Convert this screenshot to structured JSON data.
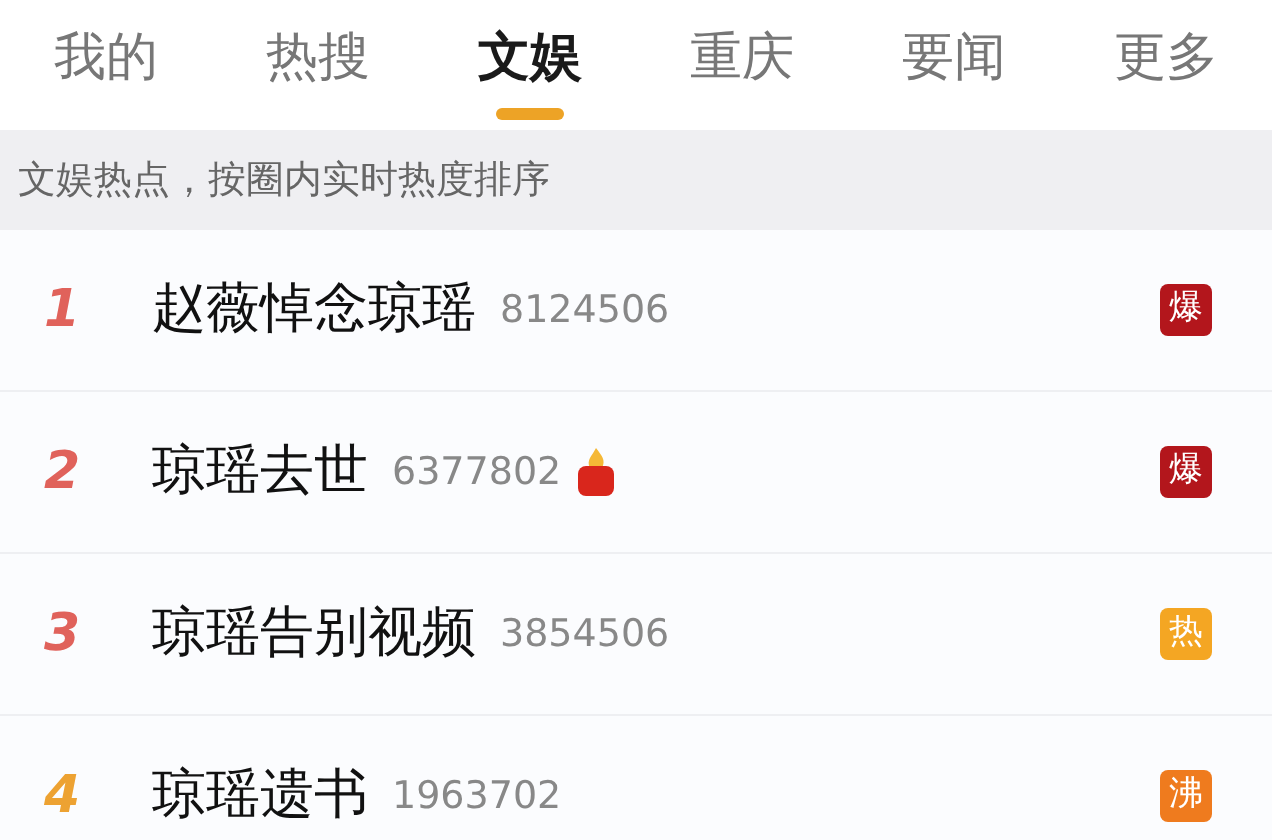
{
  "tabs": [
    {
      "label": "我的",
      "selected": false
    },
    {
      "label": "热搜",
      "selected": false
    },
    {
      "label": "文娱",
      "selected": true
    },
    {
      "label": "重庆",
      "selected": false
    },
    {
      "label": "要闻",
      "selected": false
    },
    {
      "label": "更多",
      "selected": false
    }
  ],
  "subtitle": "文娱热点，按圈内实时热度排序",
  "items": [
    {
      "rank": "1",
      "kind": "top",
      "title": "赵薇悼念琼瑶",
      "count": "8124506",
      "candle": false,
      "badge": "爆",
      "color": "#b3161c"
    },
    {
      "rank": "2",
      "kind": "top",
      "title": "琼瑶去世",
      "count": "6377802",
      "candle": true,
      "badge": "爆",
      "color": "#b3161c"
    },
    {
      "rank": "3",
      "kind": "top",
      "title": "琼瑶告别视频",
      "count": "3854506",
      "candle": false,
      "badge": "热",
      "color": "#f4a623"
    },
    {
      "rank": "4",
      "kind": "normal",
      "title": "琼瑶遗书",
      "count": "1963702",
      "candle": false,
      "badge": "沸",
      "color": "#ef7b1e"
    }
  ]
}
